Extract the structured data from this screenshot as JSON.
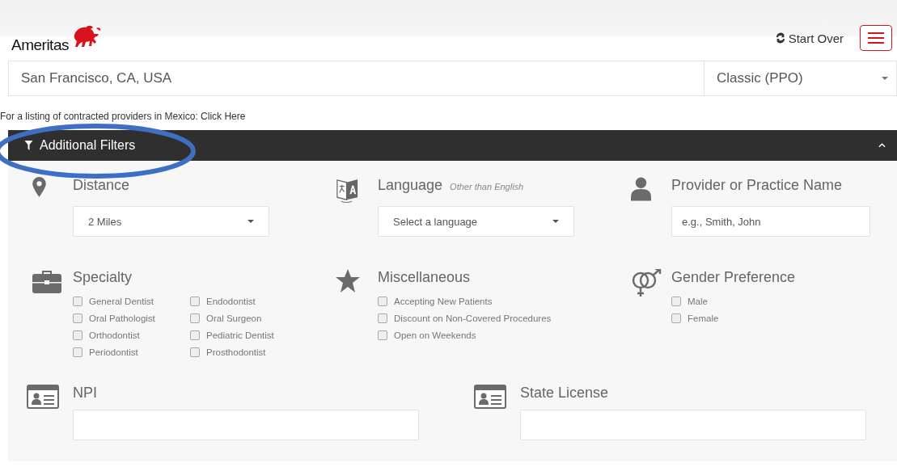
{
  "header": {
    "logo_text": "Ameritas",
    "start_over": "Start Over"
  },
  "search": {
    "location": "San Francisco, CA, USA",
    "plan": "Classic (PPO)"
  },
  "mexico_note": {
    "text": "For a listing of contracted providers in Mexico:",
    "link": "Click Here"
  },
  "filters_bar": {
    "title": "Additional Filters",
    "expanded": true
  },
  "filters": [
    {
      "kind": "select",
      "title": "Distance",
      "value": "2 Miles"
    },
    {
      "kind": "select",
      "title": "Language",
      "note": "Other than English",
      "placeholder": "Select a language"
    },
    {
      "kind": "input",
      "title": "Provider or Practice Name",
      "placeholder": "e.g., Smith, John"
    },
    {
      "kind": "checklist",
      "title": "Specialty",
      "options": [
        {
          "label": "General Dentist",
          "checked": false
        },
        {
          "label": "Oral Pathologist",
          "checked": false
        },
        {
          "label": "Orthodontist",
          "checked": false
        },
        {
          "label": "Periodontist",
          "checked": false
        },
        {
          "label": "Endodontist",
          "checked": false
        },
        {
          "label": "Oral Surgeon",
          "checked": false
        },
        {
          "label": "Pediatric Dentist",
          "checked": false
        },
        {
          "label": "Prosthodontist",
          "checked": false
        }
      ]
    },
    {
      "kind": "checklist",
      "title": "Miscellaneous",
      "options": [
        {
          "label": "Accepting New Patients",
          "checked": false
        },
        {
          "label": "Discount on Non-Covered Procedures",
          "checked": false
        },
        {
          "label": "Open on Weekends",
          "checked": false
        }
      ]
    },
    {
      "kind": "checklist",
      "title": "Gender Preference",
      "options": [
        {
          "label": "Male",
          "checked": false
        },
        {
          "label": "Female",
          "checked": false
        }
      ]
    }
  ],
  "id_fields": [
    {
      "title": "NPI"
    },
    {
      "title": "State License"
    }
  ]
}
